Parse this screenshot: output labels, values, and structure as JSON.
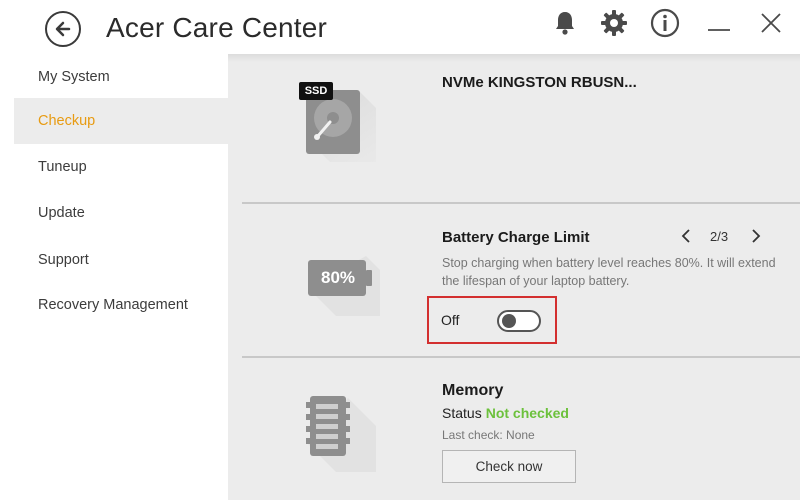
{
  "app": {
    "title": "Acer Care Center"
  },
  "sidebar": {
    "items": [
      {
        "label": "My System"
      },
      {
        "label": "Checkup"
      },
      {
        "label": "Tuneup"
      },
      {
        "label": "Update"
      },
      {
        "label": "Support"
      },
      {
        "label": "Recovery Management"
      }
    ],
    "active_index": 1
  },
  "ssd_card": {
    "badge": "SSD",
    "title": "NVMe KINGSTON RBUSN..."
  },
  "battery_card": {
    "title": "Battery Charge Limit",
    "pager": "2/3",
    "description": "Stop charging when battery level reaches 80%. It will extend the lifespan of your laptop battery.",
    "battery_label": "80%",
    "toggle_label": "Off",
    "toggle_state": false
  },
  "memory_card": {
    "title": "Memory",
    "status_label": "Status",
    "status_value": "Not checked",
    "last_check": "Last check: None",
    "button_label": "Check now"
  },
  "colors": {
    "accent": "#e89b12",
    "status_ok": "#6cc13c",
    "highlight_border": "#d32f2f"
  },
  "icons": [
    "back-arrow-icon",
    "bell-icon",
    "gear-icon",
    "info-icon",
    "minimize-icon",
    "close-icon",
    "ssd-drive-icon",
    "battery-icon",
    "memory-chip-icon",
    "chevron-left-icon",
    "chevron-right-icon"
  ]
}
